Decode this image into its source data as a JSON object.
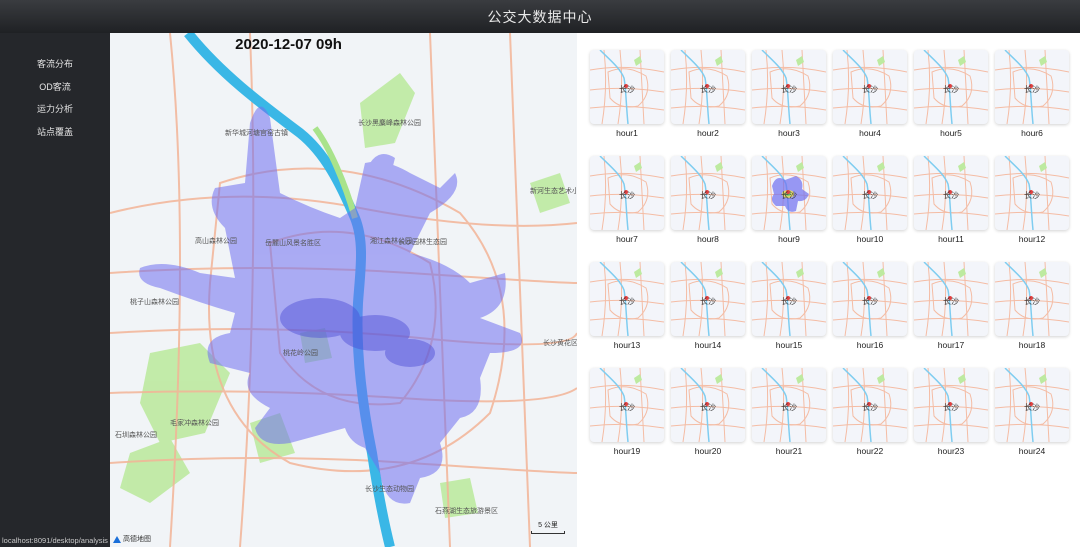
{
  "header": {
    "title": "公交大数据中心"
  },
  "sidebar": {
    "items": [
      {
        "label": "客流分布"
      },
      {
        "label": "OD客流"
      },
      {
        "label": "运力分析"
      },
      {
        "label": "站点覆盖"
      }
    ]
  },
  "status_url": "localhost:8091/desktop/analysis",
  "map": {
    "title": "2020-12-07 09h",
    "place_labels": [
      "长沙黑麋峰森林公园",
      "新河生态艺术小镇",
      "新华城河塘官窑古镇",
      "高山森林公园",
      "长沙园林生态园",
      "长沙黄花区",
      "岳麓山风景名胜区",
      "桃花岭公园",
      "毛家冲森林公园",
      "石燕湖生态旅游景区",
      "长沙生态动物园",
      "石圳森林公园",
      "湘江森林公园",
      "桃子山森林公园"
    ],
    "scale_label": "5 公里",
    "brand": "高德地图",
    "colors": {
      "heat": "#6f6ff0",
      "river": "#3ab7e6",
      "park": "#b8ea9a",
      "road": "#f3b497"
    }
  },
  "thumbnails": {
    "city_label": "长沙",
    "active_index": 8,
    "items": [
      {
        "label": "hour1"
      },
      {
        "label": "hour2"
      },
      {
        "label": "hour3"
      },
      {
        "label": "hour4"
      },
      {
        "label": "hour5"
      },
      {
        "label": "hour6"
      },
      {
        "label": "hour7"
      },
      {
        "label": "hour8"
      },
      {
        "label": "hour9"
      },
      {
        "label": "hour10"
      },
      {
        "label": "hour11"
      },
      {
        "label": "hour12"
      },
      {
        "label": "hour13"
      },
      {
        "label": "hour14"
      },
      {
        "label": "hour15"
      },
      {
        "label": "hour16"
      },
      {
        "label": "hour17"
      },
      {
        "label": "hour18"
      },
      {
        "label": "hour19"
      },
      {
        "label": "hour20"
      },
      {
        "label": "hour21"
      },
      {
        "label": "hour22"
      },
      {
        "label": "hour23"
      },
      {
        "label": "hour24"
      }
    ]
  }
}
